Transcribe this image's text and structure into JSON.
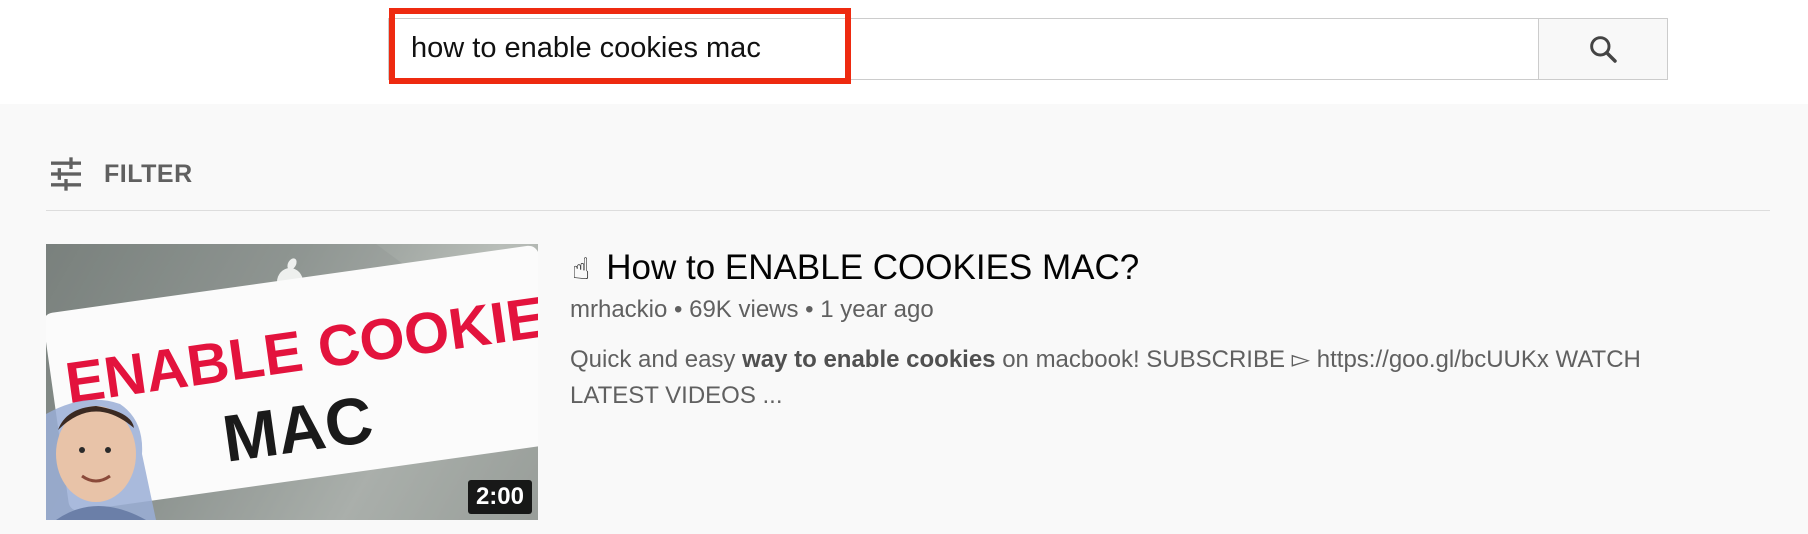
{
  "search": {
    "query": "how to enable cookies mac",
    "button_icon": "search-icon",
    "highlight_color": "#ee2a10"
  },
  "filter": {
    "label": "FILTER",
    "icon": "tune-icon"
  },
  "result": {
    "title_emoji": "☝",
    "title": "How to ENABLE COOKIES MAC?",
    "channel": "mrhackio",
    "separator": "•",
    "views": "69K views",
    "age": "1 year ago",
    "description_parts": [
      {
        "text": "Quick and easy ",
        "bold": false
      },
      {
        "text": "way to enable cookies",
        "bold": true
      },
      {
        "text": " on macbook! SUBSCRIBE ▻ https://goo.gl/bcUUKx WATCH LATEST VIDEOS ...",
        "bold": false
      }
    ],
    "thumbnail": {
      "line1": "ENABLE COOKIES",
      "line2": "MAC",
      "duration": "2:00",
      "accent": "#e3133d"
    }
  }
}
